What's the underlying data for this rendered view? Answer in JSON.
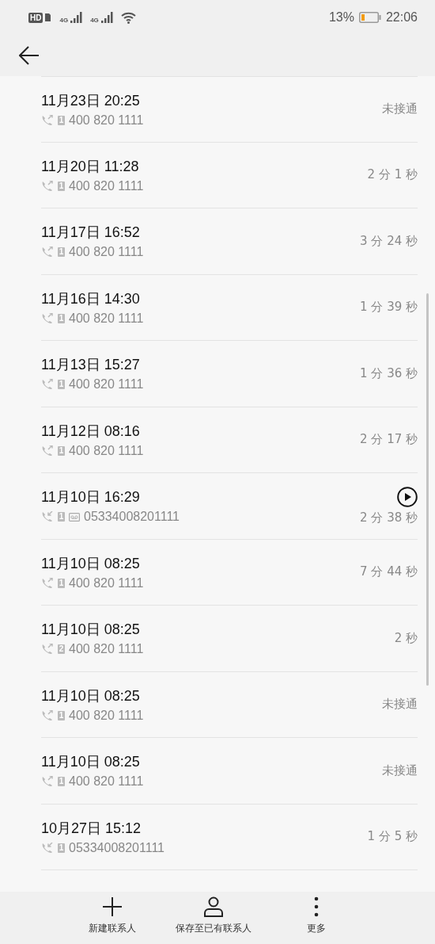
{
  "status_bar": {
    "hd": "HD",
    "networks": [
      "4G",
      "4G"
    ],
    "battery": "13%",
    "time": "22:06"
  },
  "calls": [
    {
      "date": "11月23日 20:25",
      "kind": "outgoing",
      "sim": "1",
      "recorded": false,
      "number": "400 820 1111",
      "duration": "未接通",
      "playable": false
    },
    {
      "date": "11月20日 11:28",
      "kind": "outgoing",
      "sim": "1",
      "recorded": false,
      "number": "400 820 1111",
      "duration": "2 分 1 秒",
      "playable": false
    },
    {
      "date": "11月17日 16:52",
      "kind": "outgoing",
      "sim": "1",
      "recorded": false,
      "number": "400 820 1111",
      "duration": "3 分 24 秒",
      "playable": false
    },
    {
      "date": "11月16日 14:30",
      "kind": "outgoing",
      "sim": "1",
      "recorded": false,
      "number": "400 820 1111",
      "duration": "1 分 39 秒",
      "playable": false
    },
    {
      "date": "11月13日 15:27",
      "kind": "outgoing",
      "sim": "1",
      "recorded": false,
      "number": "400 820 1111",
      "duration": "1 分 36 秒",
      "playable": false
    },
    {
      "date": "11月12日 08:16",
      "kind": "outgoing",
      "sim": "1",
      "recorded": false,
      "number": "400 820 1111",
      "duration": "2 分 17 秒",
      "playable": false
    },
    {
      "date": "11月10日 16:29",
      "kind": "incoming",
      "sim": "1",
      "recorded": true,
      "number": "05334008201111",
      "duration": "2 分 38 秒",
      "playable": true
    },
    {
      "date": "11月10日 08:25",
      "kind": "outgoing",
      "sim": "1",
      "recorded": false,
      "number": "400 820 1111",
      "duration": "7 分 44 秒",
      "playable": false
    },
    {
      "date": "11月10日 08:25",
      "kind": "outgoing",
      "sim": "2",
      "recorded": false,
      "number": "400 820 1111",
      "duration": "2 秒",
      "playable": false
    },
    {
      "date": "11月10日 08:25",
      "kind": "outgoing",
      "sim": "1",
      "recorded": false,
      "number": "400 820 1111",
      "duration": "未接通",
      "playable": false
    },
    {
      "date": "11月10日 08:25",
      "kind": "outgoing",
      "sim": "1",
      "recorded": false,
      "number": "400 820 1111",
      "duration": "未接通",
      "playable": false
    },
    {
      "date": "10月27日 15:12",
      "kind": "incoming",
      "sim": "1",
      "recorded": false,
      "number": "05334008201111",
      "duration": "1 分 5 秒",
      "playable": false
    }
  ],
  "actions": [
    {
      "label": "新建联系人",
      "kind": "add"
    },
    {
      "label": "保存至已有联系人",
      "kind": "person"
    },
    {
      "label": "更多",
      "kind": "more"
    }
  ]
}
